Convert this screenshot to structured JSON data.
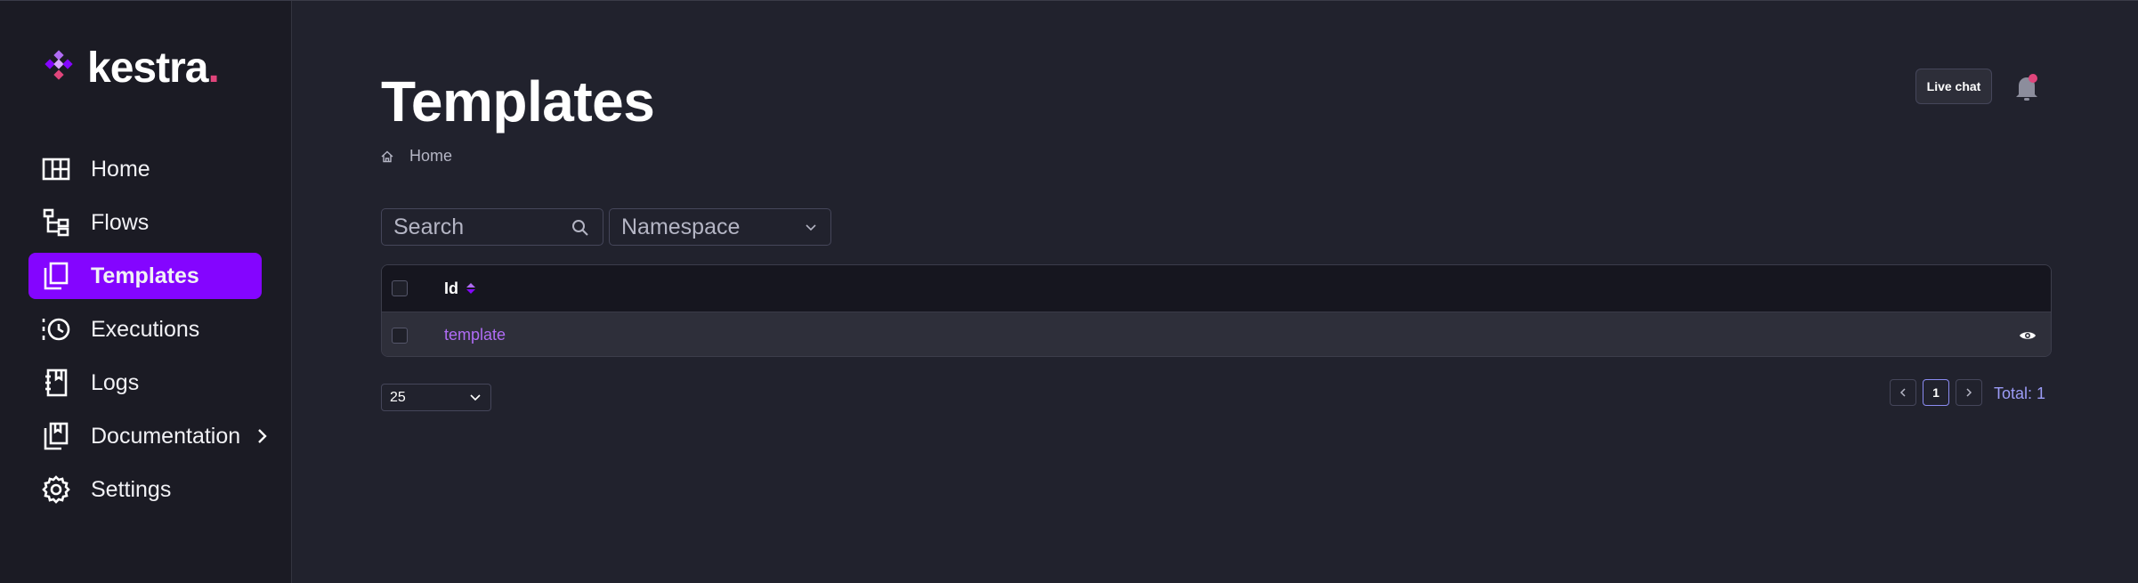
{
  "brand": {
    "name": "kestra",
    "dot": "."
  },
  "sidebar": {
    "items": [
      {
        "label": "Home",
        "icon": "home-grid-icon"
      },
      {
        "label": "Flows",
        "icon": "flows-icon"
      },
      {
        "label": "Templates",
        "icon": "templates-icon",
        "active": true
      },
      {
        "label": "Executions",
        "icon": "executions-icon"
      },
      {
        "label": "Logs",
        "icon": "logs-icon"
      },
      {
        "label": "Documentation",
        "icon": "documentation-icon",
        "has_submenu": true
      },
      {
        "label": "Settings",
        "icon": "gear-icon"
      }
    ]
  },
  "header": {
    "title": "Templates",
    "breadcrumb": "Home",
    "live_chat_label": "Live chat"
  },
  "filters": {
    "search_placeholder": "Search",
    "namespace_placeholder": "Namespace"
  },
  "table": {
    "columns": [
      {
        "label": "Id",
        "sortable": true
      }
    ],
    "rows": [
      {
        "id": "template"
      }
    ]
  },
  "pagination": {
    "page_size": "25",
    "current_page": "1",
    "total_label": "Total: 1"
  },
  "colors": {
    "accent": "#8405ff",
    "link": "#b06cf5",
    "background": "#21222d",
    "sidebar": "#1b1b24",
    "notification": "#e0457b"
  }
}
